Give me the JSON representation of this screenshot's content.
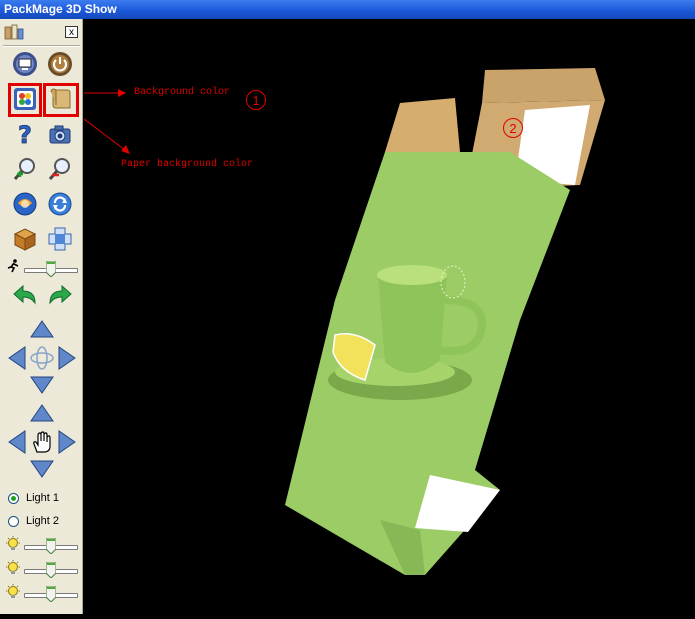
{
  "window": {
    "title": "PackMage 3D Show"
  },
  "toolbar": {
    "close_label": "x",
    "lights": [
      {
        "label": "Light 1",
        "selected": true
      },
      {
        "label": "Light 2",
        "selected": false
      }
    ],
    "speed_slider": 0.5,
    "brightness_sliders": [
      0.5,
      0.5,
      0.5
    ]
  },
  "annotations": {
    "background_color": "Background color",
    "paper_background_color": "Paper background color",
    "marker_1": "1",
    "marker_2": "2",
    "color": "#e00000"
  },
  "colors": {
    "box_green": "#9ccc65",
    "box_kraft": "#c9a36a",
    "viewport_bg": "#000000"
  }
}
